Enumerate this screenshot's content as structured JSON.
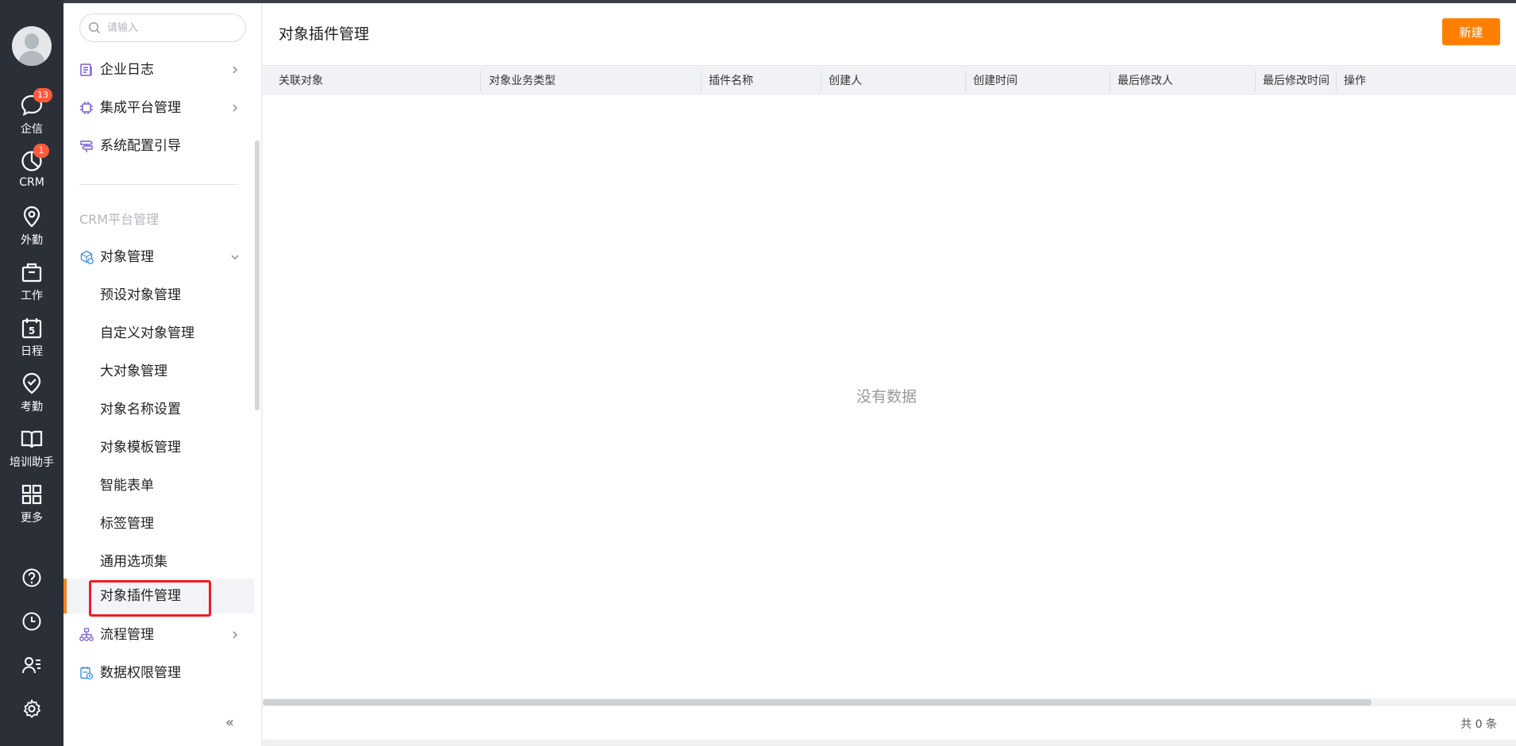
{
  "rail": {
    "items": [
      {
        "label": "企信",
        "icon": "chat-icon",
        "badge": "13"
      },
      {
        "label": "CRM",
        "icon": "crm-chart-icon",
        "badge": "1"
      },
      {
        "label": "外勤",
        "icon": "location-pin-icon"
      },
      {
        "label": "工作",
        "icon": "briefcase-icon"
      },
      {
        "label": "日程",
        "icon": "calendar-icon",
        "calendar_day": "5"
      },
      {
        "label": "考勤",
        "icon": "check-badge-icon"
      },
      {
        "label": "培训助手",
        "icon": "book-icon"
      },
      {
        "label": "更多",
        "icon": "grid-icon"
      }
    ],
    "bottom_icons": [
      "help-icon",
      "history-clock-icon",
      "contacts-icon",
      "settings-gear-icon"
    ]
  },
  "menu": {
    "search_placeholder": "请输入",
    "top_items": [
      {
        "label": "企业日志",
        "icon": "log-icon"
      },
      {
        "label": "集成平台管理",
        "icon": "chip-icon"
      },
      {
        "label": "系统配置引导",
        "icon": "signpost-icon"
      }
    ],
    "section_title": "CRM平台管理",
    "object_management": {
      "label": "对象管理",
      "icon": "object-cube-icon",
      "children": [
        "预设对象管理",
        "自定义对象管理",
        "大对象管理",
        "对象名称设置",
        "对象模板管理",
        "智能表单",
        "标签管理",
        "通用选项集",
        "对象插件管理"
      ],
      "active_index": 8
    },
    "bottom_items": [
      {
        "label": "流程管理",
        "icon": "flow-icon"
      },
      {
        "label": "数据权限管理",
        "icon": "data-permission-icon"
      }
    ],
    "collapse_glyph": "«"
  },
  "content": {
    "title": "对象插件管理",
    "new_button": "新建",
    "columns": [
      "关联对象",
      "对象业务类型",
      "插件名称",
      "创建人",
      "创建时间",
      "最后修改人",
      "最后修改时间",
      "操作"
    ],
    "empty_text": "没有数据",
    "total_text": "共 0 条"
  },
  "colors": {
    "rail_bg": "#2b3038",
    "accent_orange": "#ff8000",
    "badge_red": "#ff5a3c",
    "highlight_red": "#ee1d24",
    "menu_icon_purple": "#7b5cd6",
    "menu_icon_blue": "#3d8fe6"
  }
}
